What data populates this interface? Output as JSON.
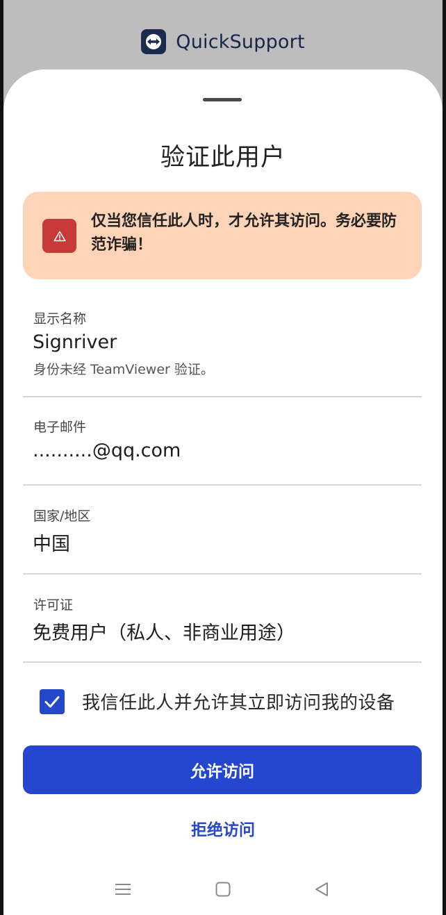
{
  "app": {
    "title": "QuickSupport"
  },
  "sheet": {
    "title": "验证此用户",
    "warning": "仅当您信任此人时，才允许其访问。务必要防范诈骗！"
  },
  "fields": [
    {
      "label": "显示名称",
      "value": "Signriver",
      "note": "身份未经 TeamViewer 验证。"
    },
    {
      "label": "电子邮件",
      "value": "..........@qq.com"
    },
    {
      "label": "国家/地区",
      "value": "中国"
    },
    {
      "label": "许可证",
      "value": "免费用户（私人、非商业用途）"
    }
  ],
  "consent": {
    "checked": true,
    "label": "我信任此人并允许其立即访问我的设备"
  },
  "actions": {
    "allow_label": "允许访问",
    "deny_label": "拒绝访问"
  },
  "icons": {
    "logo": "teamviewer-logo-icon",
    "warning": "warning-triangle-icon",
    "check": "checkmark-icon",
    "nav_menu": "menu-icon",
    "nav_home": "home-square-icon",
    "nav_back": "back-triangle-icon"
  },
  "colors": {
    "brand_blue": "#2547d0",
    "warning_bg": "#fed4b9",
    "warning_icon_bg": "#c8393a",
    "logo_bg": "#1b2a4e"
  }
}
